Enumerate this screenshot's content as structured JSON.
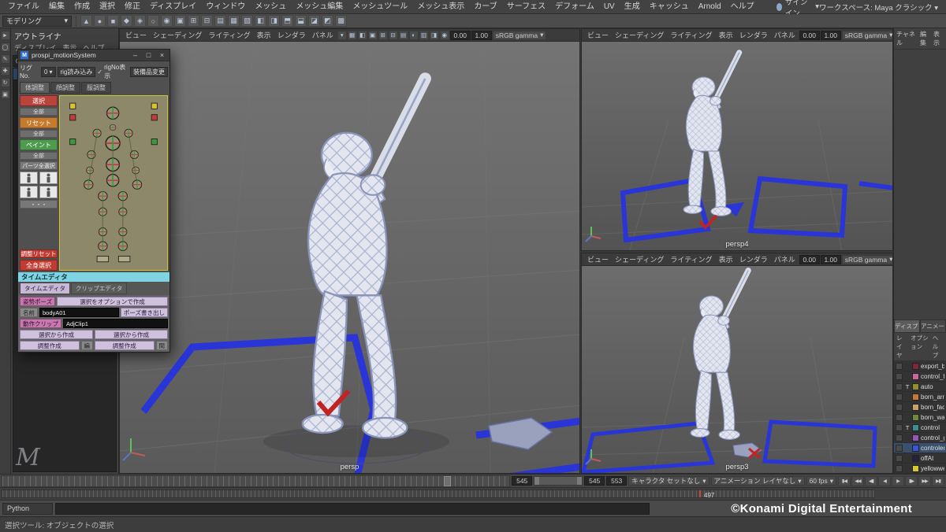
{
  "app": {
    "menus": [
      "ファイル",
      "編集",
      "作成",
      "選択",
      "修正",
      "ディスプレイ",
      "ウィンドウ",
      "メッシュ",
      "メッシュ編集",
      "メッシュツール",
      "メッシュ表示",
      "カーブ",
      "サーフェス",
      "デフォーム",
      "UV",
      "生成",
      "キャッシュ",
      "Arnold",
      "ヘルプ"
    ],
    "signin_label": "サインイン",
    "workspace_label": "ワークスペース: Maya クラシック",
    "mode_selector": "モデリング"
  },
  "toolbox": {
    "tools": [
      {
        "name": "select-tool-icon",
        "glyph": "►"
      },
      {
        "name": "lasso-tool-icon",
        "glyph": "◯"
      },
      {
        "name": "paint-select-tool-icon",
        "glyph": "✎"
      },
      {
        "name": "move-tool-icon",
        "glyph": "✚"
      },
      {
        "name": "rotate-tool-icon",
        "glyph": "↻"
      },
      {
        "name": "scale-tool-icon",
        "glyph": "▣"
      }
    ]
  },
  "shelf": {
    "icons": [
      "▲",
      "●",
      "■",
      "◆",
      "◈",
      "○",
      "◉",
      "▣",
      "⊞",
      "⊟",
      "▤",
      "▦",
      "▧",
      "◧",
      "◨",
      "⬒",
      "⬓",
      "◪",
      "◩",
      "▩"
    ]
  },
  "outliner": {
    "title": "アウトライナ",
    "menus": [
      "ディスプレイ",
      "表示",
      "ヘルプ"
    ]
  },
  "viewport": {
    "menus": [
      "ビュー",
      "シェーディング",
      "ライティング",
      "表示",
      "レンダラ",
      "パネル"
    ],
    "header_icons": [
      "▾",
      "▦",
      "◧",
      "▣",
      "⊞",
      "⊟",
      "▤",
      "◐",
      "▥",
      "◨"
    ],
    "exposure": "0.00",
    "gamma": "1.00",
    "view_transform": "sRGB gamma",
    "labels": {
      "main": "persp",
      "top_right": "persp4",
      "bottom_right": "persp3"
    }
  },
  "motion_window": {
    "title": "prospi_motionSystem",
    "rig_label": "リグNo.",
    "rig_value": "0",
    "load_button": "rig読み込み",
    "rig_checkbox": "rigNo表示",
    "equip_button": "装備品変更",
    "tabs": [
      "体調整",
      "顔調整",
      "服調整"
    ],
    "select_button": "選択",
    "select_all_button": "全部",
    "reset_button": "リセット",
    "reset_all_button": "全部",
    "paint_button": "ペイント",
    "paint_all_button": "全部",
    "parts_all_button": "パーツ全選択",
    "more_button": "・・・",
    "adjust_reset_button": "調整リセット",
    "whole_body_button": "全身選択",
    "time_editor_title": "タイムエディタ",
    "editor_tabs": [
      "タイムエディタ",
      "クリップエディタ"
    ],
    "pose_label": "姿勢ポーズ",
    "pose_create_button": "選択をオプションで作成",
    "name_label": "名前",
    "name_value": "bodyA01",
    "pose_export_button": "ポーズ書き出し",
    "clip_label": "動作クリップ",
    "clip_value": "AdjClip1",
    "create_left": "選択から作成",
    "create_right": "選択から作成",
    "adjust_left": "調整作成",
    "adjust_left_small": "編",
    "adjust_right": "調整作成",
    "adjust_right_small": "間"
  },
  "right_panel": {
    "channel_menus": [
      "チャネル",
      "編集",
      "表示"
    ],
    "tabs": [
      "ディスプレイ",
      "アニメーション"
    ],
    "layer_menus": [
      "レイヤ",
      "オプション",
      "ヘルプ"
    ],
    "layers": [
      {
        "tag": "",
        "color": "#7c2638",
        "name": "export_bc",
        "selected": false
      },
      {
        "tag": "",
        "color": "#c9659b",
        "name": "control_fc",
        "selected": false
      },
      {
        "tag": "T",
        "color": "#8f8f2f",
        "name": "auto",
        "selected": false
      },
      {
        "tag": "",
        "color": "#c07a36",
        "name": "born_arm",
        "selected": false
      },
      {
        "tag": "",
        "color": "#c7a26b",
        "name": "born_face",
        "selected": false
      },
      {
        "tag": "",
        "color": "#6e8a3c",
        "name": "born_wais",
        "selected": false
      },
      {
        "tag": "T",
        "color": "#3c8e8e",
        "name": "control",
        "selected": false
      },
      {
        "tag": "",
        "color": "#9757b9",
        "name": "control_g",
        "selected": false
      },
      {
        "tag": "",
        "color": "#3a55d9",
        "name": "controler",
        "selected": true
      },
      {
        "tag": "",
        "color": "#23233d",
        "name": "offAt",
        "selected": false
      },
      {
        "tag": "",
        "color": "#d6c92f",
        "name": "yellowweb",
        "selected": false
      }
    ]
  },
  "timeline": {
    "current_frame": "497",
    "playback_end": "545",
    "anim_end": "545",
    "range_end": "553",
    "character_set": "キャラクタ セットなし",
    "anim_layer": "アニメーション レイヤなし",
    "fps": "60 fps",
    "transport": [
      {
        "name": "go-to-range-start-icon",
        "glyph": "▮◀"
      },
      {
        "name": "step-back-frame-icon",
        "glyph": "◀◀"
      },
      {
        "name": "step-back-key-icon",
        "glyph": "◀▮"
      },
      {
        "name": "play-backwards-icon",
        "glyph": "◀"
      },
      {
        "name": "play-forwards-icon",
        "glyph": "▶"
      },
      {
        "name": "step-forward-key-icon",
        "glyph": "▮▶"
      },
      {
        "name": "step-forward-frame-icon",
        "glyph": "▶▶"
      },
      {
        "name": "go-to-range-end-icon",
        "glyph": "▶▮"
      }
    ]
  },
  "command_line": {
    "label": "Python"
  },
  "help_line": {
    "text": "選択ツール: オブジェクトの選択"
  },
  "watermark": "©Konami Digital Entertainment"
}
